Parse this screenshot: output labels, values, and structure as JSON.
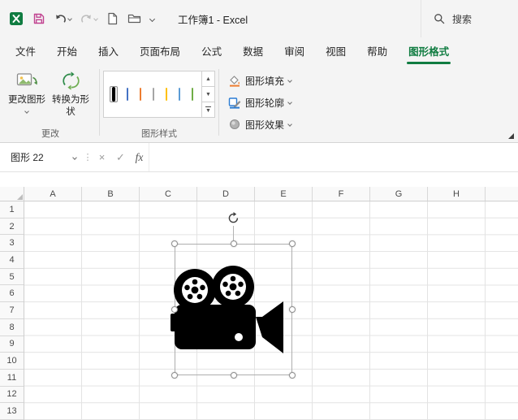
{
  "titlebar": {
    "title": "工作簿1 - Excel",
    "search_label": "搜索"
  },
  "tabs": [
    {
      "label": "文件"
    },
    {
      "label": "开始"
    },
    {
      "label": "插入"
    },
    {
      "label": "页面布局"
    },
    {
      "label": "公式"
    },
    {
      "label": "数据"
    },
    {
      "label": "审阅"
    },
    {
      "label": "视图"
    },
    {
      "label": "帮助"
    },
    {
      "label": "图形格式"
    }
  ],
  "ribbon": {
    "change_group": {
      "label": "更改",
      "change_shape_label": "更改图形",
      "convert_label": "转换为形状"
    },
    "styles_group": {
      "label": "图形样式",
      "swatches": [
        "#000000",
        "#4472C4",
        "#ED7D31",
        "#A5A5A5",
        "#FFC000",
        "#5B9BD5",
        "#70AD47"
      ]
    },
    "format_group": {
      "fill_label": "图形填充",
      "outline_label": "图形轮廓",
      "effects_label": "图形效果"
    }
  },
  "formula_bar": {
    "name_box_value": "图形 22",
    "formula_value": ""
  },
  "grid": {
    "columns": [
      "A",
      "B",
      "C",
      "D",
      "E",
      "F",
      "G",
      "H"
    ],
    "rows": [
      "1",
      "2",
      "3",
      "4",
      "5",
      "6",
      "7",
      "8",
      "9",
      "10",
      "11",
      "12",
      "13"
    ]
  },
  "glyphs": {
    "gallery_up": "▲",
    "gallery_down": "▼",
    "gallery_more": "▼",
    "cancel": "×",
    "check": "✓",
    "fx": "fx",
    "name_box_dots": "⋮"
  },
  "colors": {
    "excel_green": "#107C41"
  }
}
